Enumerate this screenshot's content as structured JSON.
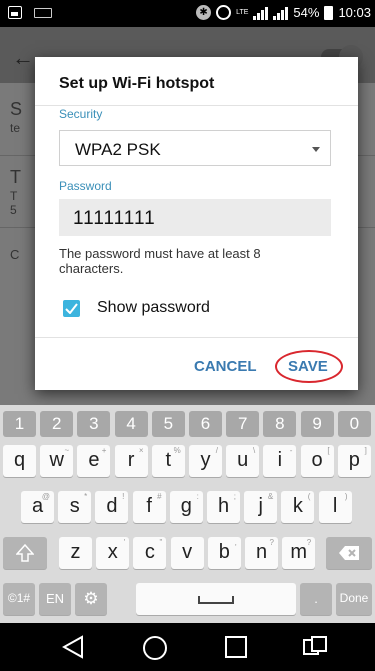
{
  "status_bar": {
    "battery_percent": "54%",
    "time": "10:03",
    "lte_label": "LTE"
  },
  "background": {
    "row1_letter": "S",
    "row1_sub": "te",
    "row2_letter": "T",
    "row2_sub1": "T",
    "row2_sub2": "5",
    "row3_letter": "C"
  },
  "dialog": {
    "title": "Set up Wi-Fi hotspot",
    "security_label": "Security",
    "security_value": "WPA2 PSK",
    "password_label": "Password",
    "password_value": "11111111",
    "password_hint": "The password must have at least 8 characters.",
    "show_password_label": "Show password",
    "show_password_checked": true,
    "cancel_label": "CANCEL",
    "save_label": "SAVE",
    "accent_color": "#3cb4de",
    "annotation_color": "#d9272e"
  },
  "keyboard": {
    "number_row": [
      "1",
      "2",
      "3",
      "4",
      "5",
      "6",
      "7",
      "8",
      "9",
      "0"
    ],
    "row1": [
      {
        "k": "q",
        "h": ""
      },
      {
        "k": "w",
        "h": "~"
      },
      {
        "k": "e",
        "h": "+"
      },
      {
        "k": "r",
        "h": "×"
      },
      {
        "k": "t",
        "h": "%"
      },
      {
        "k": "y",
        "h": "/"
      },
      {
        "k": "u",
        "h": "\\"
      },
      {
        "k": "i",
        "h": "-"
      },
      {
        "k": "o",
        "h": "["
      },
      {
        "k": "p",
        "h": "]"
      }
    ],
    "row2": [
      {
        "k": "a",
        "h": "@"
      },
      {
        "k": "s",
        "h": "*"
      },
      {
        "k": "d",
        "h": "!"
      },
      {
        "k": "f",
        "h": "#"
      },
      {
        "k": "g",
        "h": ":"
      },
      {
        "k": "h",
        "h": ";"
      },
      {
        "k": "j",
        "h": "&"
      },
      {
        "k": "k",
        "h": "("
      },
      {
        "k": "l",
        "h": ")"
      }
    ],
    "row3": [
      {
        "k": "z",
        "h": ""
      },
      {
        "k": "x",
        "h": "'"
      },
      {
        "k": "c",
        "h": "\""
      },
      {
        "k": "v",
        "h": ""
      },
      {
        "k": "b",
        "h": ","
      },
      {
        "k": "n",
        "h": "?"
      },
      {
        "k": "m",
        "h": "?"
      }
    ],
    "symbols_label": "©1#",
    "language_label": "EN",
    "period_label": ".",
    "done_label": "Done"
  }
}
